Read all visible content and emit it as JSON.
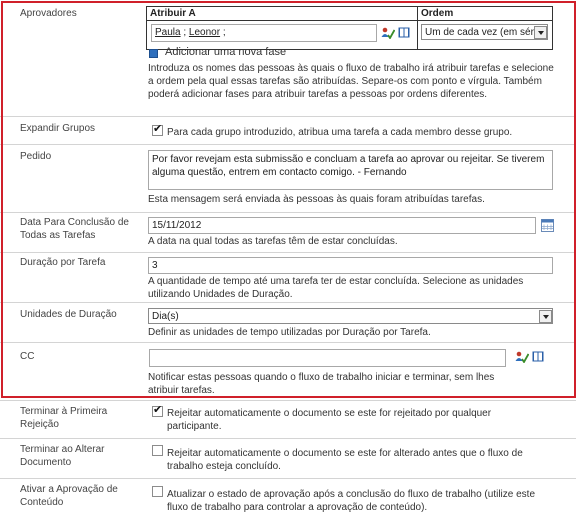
{
  "approvers": {
    "label": "Aprovadores",
    "col_assign": "Atribuir A",
    "col_order": "Ordem",
    "people": [
      "Paula",
      "Leonor"
    ],
    "order_value": "Um de cada vez (em sér",
    "add_stage": "Adicionar uma nova fase",
    "description": "Introduza os nomes das pessoas às quais o fluxo de trabalho irá atribuir tarefas e selecione a ordem pela qual essas tarefas são atribuídas. Separe-os com ponto e vírgula. Também poderá adicionar fases para atribuir tarefas a pessoas por ordens diferentes."
  },
  "expand_groups": {
    "label": "Expandir Grupos",
    "checkbox_label": "Para cada grupo introduzido, atribua uma tarefa a cada membro desse grupo.",
    "checked": true
  },
  "request": {
    "label": "Pedido",
    "value": "Por favor revejam esta submissão e concluam a tarefa ao aprovar ou rejeitar. Se tiverem alguma questão, entrem em contacto comigo. - Fernando",
    "description": "Esta mensagem será enviada às pessoas às quais foram atribuídas tarefas."
  },
  "due_date": {
    "label": "Data Para Conclusão de Todas as Tarefas",
    "value": "15/11/2012",
    "description": "A data na qual todas as tarefas têm de estar concluídas."
  },
  "duration": {
    "label": "Duração por Tarefa",
    "value": "3",
    "description": "A quantidade de tempo até uma tarefa ter de estar concluída. Selecione as unidades utilizando Unidades de Duração."
  },
  "duration_units": {
    "label": "Unidades de Duração",
    "value": "Dia(s)",
    "description": "Definir as unidades de tempo utilizadas por Duração por Tarefa."
  },
  "cc": {
    "label": "CC",
    "value": "",
    "description": "Notificar estas pessoas quando o fluxo de trabalho iniciar e terminar, sem lhes atribuir tarefas."
  },
  "end_on_first_rejection": {
    "label": "Terminar à Primeira Rejeição",
    "checkbox_label": "Rejeitar automaticamente o documento se este for rejeitado por qualquer participante.",
    "checked": true
  },
  "end_on_document_change": {
    "label": "Terminar ao Alterar Documento",
    "checkbox_label": "Rejeitar automaticamente o documento se este for alterado antes que o fluxo de trabalho esteja concluído.",
    "checked": false
  },
  "enable_content_approval": {
    "label": "Ativar a Aprovação de Conteúdo",
    "checkbox_label": "Atualizar o estado de aprovação após a conclusão do fluxo de trabalho (utilize este fluxo de trabalho para controlar a aprovação de conteúdo).",
    "checked": false
  },
  "colors": {
    "highlight_border": "#d0202a",
    "row_border": "#d4d4d4"
  },
  "icons": [
    "check-names-icon",
    "address-book-icon",
    "calendar-icon",
    "add-stage-icon",
    "dropdown-arrow-icon"
  ]
}
